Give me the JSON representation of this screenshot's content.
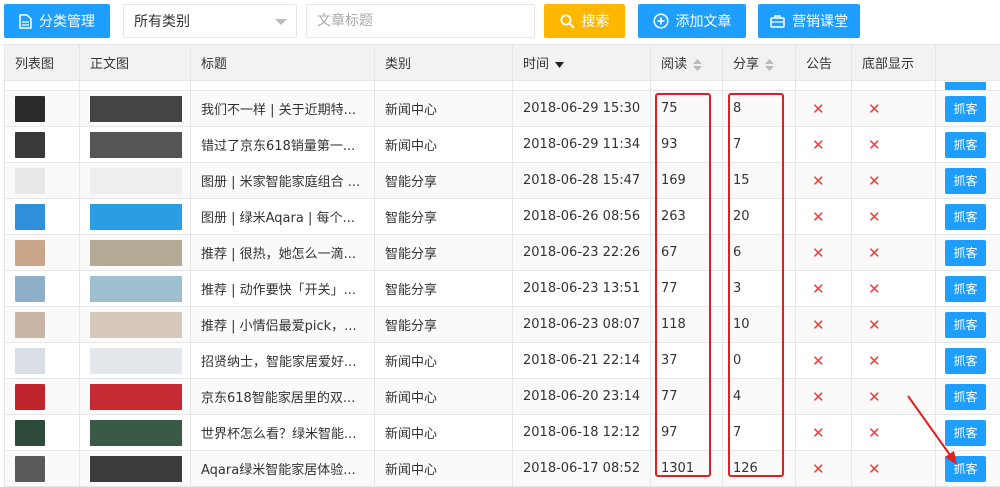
{
  "toolbar": {
    "manage_label": "分类管理",
    "category_value": "所有类别",
    "title_placeholder": "文章标题",
    "search_label": "搜索",
    "add_label": "添加文章",
    "course_label": "营销课堂"
  },
  "columns": [
    "列表图",
    "正文图",
    "标题",
    "类别",
    "时间",
    "阅读",
    "分享",
    "公告",
    "底部显示"
  ],
  "colors": {
    "primary": "#1e9fff",
    "search": "#ffb800",
    "delete": "#ff3333",
    "annotation": "#e02020"
  },
  "rows": [
    {
      "title": "我们不一样 | 关于近期特...",
      "category": "新闻中心",
      "time": "2018-06-29 15:30",
      "reads": "75",
      "shares": "8",
      "notice": "✕",
      "bottom": "✕",
      "action": "抓客",
      "thumb": "#2b2b2b",
      "thumb2": "#444444"
    },
    {
      "title": "错过了京东618销量第一...",
      "category": "新闻中心",
      "time": "2018-06-29 11:34",
      "reads": "93",
      "shares": "7",
      "notice": "✕",
      "bottom": "✕",
      "action": "抓客",
      "thumb": "#3a3a3a",
      "thumb2": "#555555"
    },
    {
      "title": "图册 | 米家智能家庭组合 ...",
      "category": "智能分享",
      "time": "2018-06-28 15:47",
      "reads": "169",
      "shares": "15",
      "notice": "✕",
      "bottom": "✕",
      "action": "抓客",
      "thumb": "#e8e8e8",
      "thumb2": "#eeeeee"
    },
    {
      "title": "图册 | 绿米Aqara | 每个...",
      "category": "智能分享",
      "time": "2018-06-26 08:56",
      "reads": "263",
      "shares": "20",
      "notice": "✕",
      "bottom": "✕",
      "action": "抓客",
      "thumb": "#2f8fd8",
      "thumb2": "#2a9ee0"
    },
    {
      "title": "推荐 | 很热，她怎么一滴...",
      "category": "智能分享",
      "time": "2018-06-23 22:26",
      "reads": "67",
      "shares": "6",
      "notice": "✕",
      "bottom": "✕",
      "action": "抓客",
      "thumb": "#c9a68a",
      "thumb2": "#b3a994"
    },
    {
      "title": "推荐 | 动作要快「开关」...",
      "category": "智能分享",
      "time": "2018-06-23 13:51",
      "reads": "77",
      "shares": "3",
      "notice": "✕",
      "bottom": "✕",
      "action": "抓客",
      "thumb": "#8fb0c8",
      "thumb2": "#9fc0d0"
    },
    {
      "title": "推荐 | 小情侣最爱pick，...",
      "category": "智能分享",
      "time": "2018-06-23 08:07",
      "reads": "118",
      "shares": "10",
      "notice": "✕",
      "bottom": "✕",
      "action": "抓客",
      "thumb": "#c8b5a5",
      "thumb2": "#d6c8bb"
    },
    {
      "title": "招贤纳士，智能家居爱好...",
      "category": "新闻中心",
      "time": "2018-06-21 22:14",
      "reads": "37",
      "shares": "0",
      "notice": "✕",
      "bottom": "✕",
      "action": "抓客",
      "thumb": "#d9dde4",
      "thumb2": "#e4e7ec"
    },
    {
      "title": "京东618智能家居里的双...",
      "category": "新闻中心",
      "time": "2018-06-20 23:14",
      "reads": "77",
      "shares": "4",
      "notice": "✕",
      "bottom": "✕",
      "action": "抓客",
      "thumb": "#c0242c",
      "thumb2": "#c62a32"
    },
    {
      "title": "世界杯怎么看？绿米智能...",
      "category": "新闻中心",
      "time": "2018-06-18 12:12",
      "reads": "97",
      "shares": "7",
      "notice": "✕",
      "bottom": "✕",
      "action": "抓客",
      "thumb": "#2d4a3a",
      "thumb2": "#3a5a48"
    },
    {
      "title": "Aqara绿米智能家居体验...",
      "category": "新闻中心",
      "time": "2018-06-17 08:52",
      "reads": "1301",
      "shares": "126",
      "notice": "✕",
      "bottom": "✕",
      "action": "抓客",
      "thumb": "#5a5a5a",
      "thumb2": "#3c3c3c"
    }
  ]
}
